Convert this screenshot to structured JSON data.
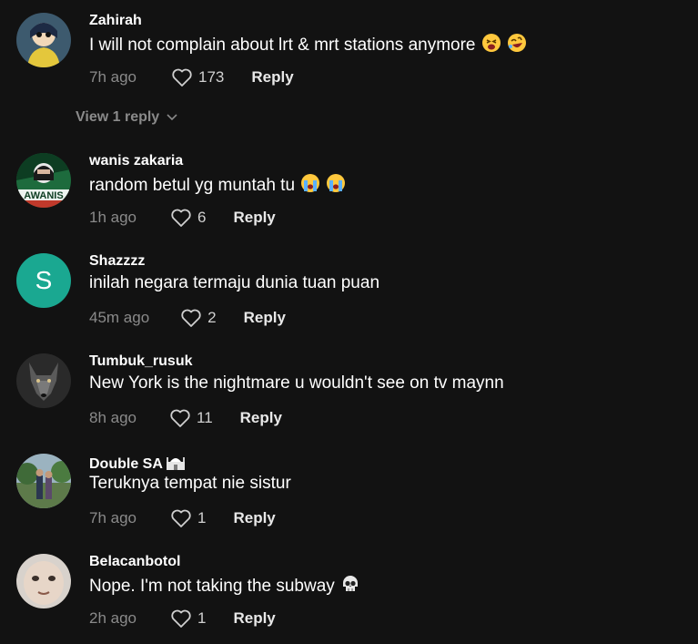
{
  "comments": [
    {
      "username": "Zahirah",
      "text": "I will not complain about lrt & mrt stations anymore",
      "emojis": [
        "tired-face",
        "rolling-laughing"
      ],
      "time": "7h ago",
      "likes": "173",
      "reply_label": "Reply",
      "view_replies": "View 1 reply",
      "avatar": "cartoon-girl"
    },
    {
      "username": "wanis zakaria",
      "text": "random betul yg muntah tu",
      "emojis": [
        "loudly-crying",
        "loudly-crying"
      ],
      "time": "1h ago",
      "likes": "6",
      "reply_label": "Reply",
      "avatar": "wanis-logo",
      "avatar_label": "AWANIS"
    },
    {
      "username": "Shazzzz",
      "text": "inilah negara termaju dunia tuan puan",
      "time": "45m ago",
      "likes": "2",
      "reply_label": "Reply",
      "avatar": "letter",
      "avatar_letter": "S"
    },
    {
      "username": "Tumbuk_rusuk",
      "text": "New York is the nightmare u wouldn't see on tv maynn",
      "time": "8h ago",
      "likes": "11",
      "reply_label": "Reply",
      "avatar": "wolf-photo"
    },
    {
      "username": "Double SA",
      "username_badge": "mosque",
      "text": "Teruknya tempat nie sistur",
      "time": "7h ago",
      "likes": "1",
      "reply_label": "Reply",
      "avatar": "couple-photo"
    },
    {
      "username": "Belacanbotol",
      "text": "Nope. I'm not taking the subway",
      "emojis": [
        "skull"
      ],
      "time": "2h ago",
      "likes": "1",
      "reply_label": "Reply",
      "avatar": "face-meme"
    }
  ],
  "colors": {
    "background": "#121212",
    "text_primary": "#ffffff",
    "text_secondary": "#8a8a8a",
    "letter_avatar": "#1aa891"
  }
}
